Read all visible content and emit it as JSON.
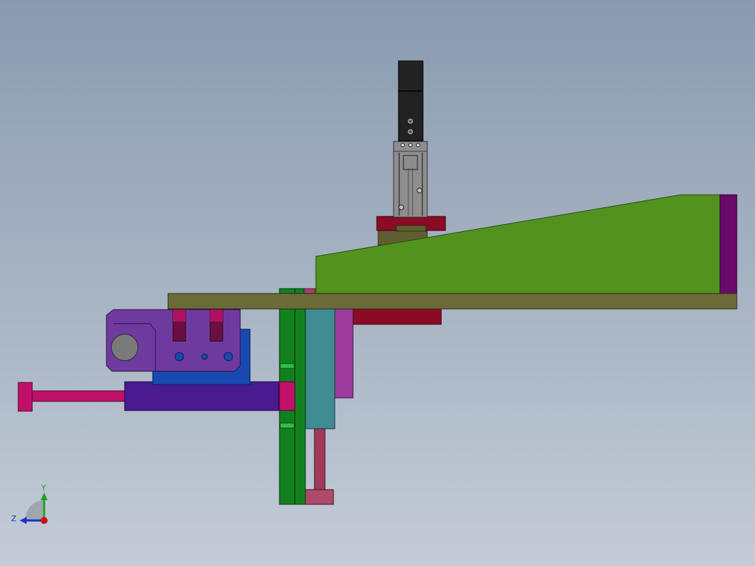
{
  "viewport": {
    "background_top": "#8a9bb0",
    "background_bottom": "#c3cbd6"
  },
  "triad": {
    "y_label": "Y",
    "z_label": "Z",
    "y_color": "#1fa31f",
    "z_color": "#1f2fc8",
    "x_color": "#cc1111"
  },
  "colors": {
    "base_plate": "#6b6b38",
    "wedge": "#52921e",
    "wedge_end_plate": "#6a0a6a",
    "gripper_body": "#222222",
    "gripper_slide": "#8e8e8e",
    "gripper_flange": "#8b0a24",
    "gripper_mount": "#5e5e30",
    "under_block": "#8b0a24",
    "green_column": "#12801e",
    "teal_cylinder": "#3f8c93",
    "magenta_strip": "#9c3c9c",
    "rod": "#a03a5a",
    "rod_foot": "#b04a6a",
    "violet_bracket": "#6f3aa0",
    "blue_block": "#1848b0",
    "purple_slide": "#4a1a90",
    "side_rod": "#c0106a",
    "end_cap": "#c0106a"
  }
}
